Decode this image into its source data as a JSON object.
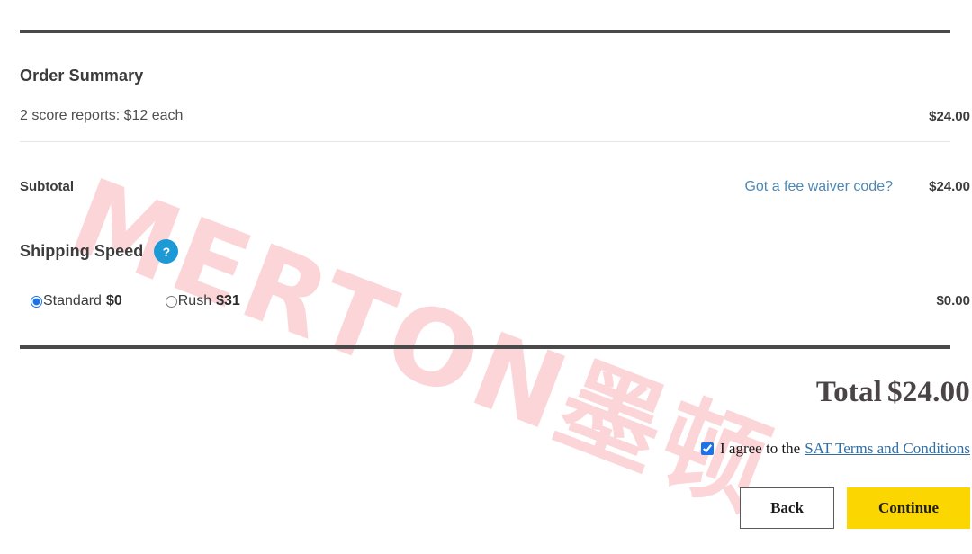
{
  "watermark": {
    "text": "MERTON墨顿",
    "color": "#fbd3d6"
  },
  "order_summary": {
    "title": "Order Summary",
    "line_item": {
      "description": "2 score reports: $12 each",
      "amount": "$24.00"
    },
    "subtotal": {
      "label": "Subtotal",
      "fee_waiver_link": "Got a fee waiver code?",
      "amount": "$24.00"
    }
  },
  "shipping": {
    "label": "Shipping Speed",
    "help_icon": "?",
    "amount": "$0.00",
    "options": [
      {
        "name": "Standard",
        "price": "$0",
        "selected": true
      },
      {
        "name": "Rush",
        "price": "$31",
        "selected": false
      }
    ]
  },
  "total": {
    "label": "Total",
    "amount": "$24.00"
  },
  "agreement": {
    "checked": true,
    "text": "I agree to the",
    "link_text": "SAT Terms and Conditions"
  },
  "actions": {
    "back_label": "Back",
    "continue_label": "Continue"
  },
  "colors": {
    "accent_blue": "#1b9ad6",
    "link_blue": "#4d88b5",
    "terms_link_blue": "#2f6ea5",
    "continue_yellow": "#fbd601",
    "rule_dark": "#4a4a4a",
    "rule_light": "#e4e4e4"
  }
}
